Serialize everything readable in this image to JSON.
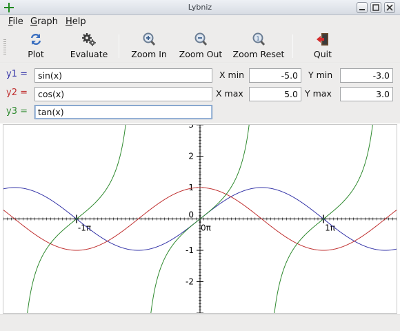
{
  "window": {
    "title": "Lybniz"
  },
  "menu": [
    {
      "label": "File",
      "mnemonic": "F",
      "rest": "ile"
    },
    {
      "label": "Graph",
      "mnemonic": "G",
      "rest": "raph"
    },
    {
      "label": "Help",
      "mnemonic": "H",
      "rest": "elp"
    }
  ],
  "toolbar": {
    "plot": "Plot",
    "evaluate": "Evaluate",
    "zoom_in": "Zoom In",
    "zoom_out": "Zoom Out",
    "zoom_reset": "Zoom Reset",
    "quit": "Quit"
  },
  "functions": [
    {
      "label": "y1 =",
      "value": "sin(x)",
      "color": "#3535a8"
    },
    {
      "label": "y2 =",
      "value": "cos(x)",
      "color": "#c03030"
    },
    {
      "label": "y3 =",
      "value": "tan(x)",
      "color": "#2f8a2f"
    }
  ],
  "range": {
    "xmin_label": "X min",
    "xmin": "-5.0",
    "xmax_label": "X max",
    "xmax": "5.0",
    "ymin_label": "Y min",
    "ymin": "-3.0",
    "ymax_label": "Y max",
    "ymax": "3.0"
  },
  "chart_data": {
    "type": "line",
    "xlim": [
      -5.0,
      5.0
    ],
    "ylim": [
      -3.0,
      3.0
    ],
    "x_tick_labels": [
      "-1π",
      "0π",
      "1π"
    ],
    "y_tick_labels": [
      "3",
      "2",
      "1",
      "0",
      "-1",
      "-2"
    ],
    "series": [
      {
        "name": "y1 = sin(x)",
        "expr": "sin",
        "color": "#3535a8"
      },
      {
        "name": "y2 = cos(x)",
        "expr": "cos",
        "color": "#c03030"
      },
      {
        "name": "y3 = tan(x)",
        "expr": "tan",
        "color": "#2f8a2f"
      }
    ]
  }
}
